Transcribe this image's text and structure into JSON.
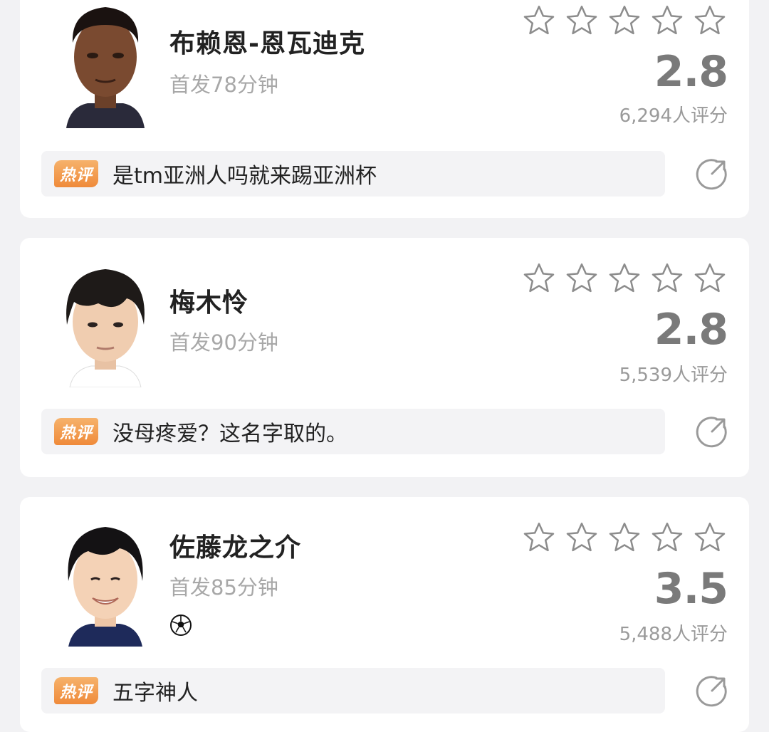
{
  "players": [
    {
      "name": "布赖恩-恩瓦迪克",
      "minutes": "首发78分钟",
      "score": "2.8",
      "raters": "6,294人评分",
      "hot_label": "热评",
      "comment": "是tm亚洲人吗就来踢亚洲杯",
      "user_stars": 0
    },
    {
      "name": "梅木怜",
      "minutes": "首发90分钟",
      "score": "2.8",
      "raters": "5,539人评分",
      "hot_label": "热评",
      "comment": "没母疼爱？这名字取的。",
      "user_stars": 0
    },
    {
      "name": "佐藤龙之介",
      "minutes": "首发85分钟",
      "score": "3.5",
      "raters": "5,488人评分",
      "hot_label": "热评",
      "comment": "五字神人",
      "event_icon": "soccer-ball-icon",
      "user_stars": 0
    }
  ],
  "colors": {
    "page_bg": "#f2f2f4",
    "card_bg": "#ffffff",
    "badge": "#ef8a3a",
    "score": "#7a7a7a",
    "star_outline": "#8c8c8c"
  }
}
